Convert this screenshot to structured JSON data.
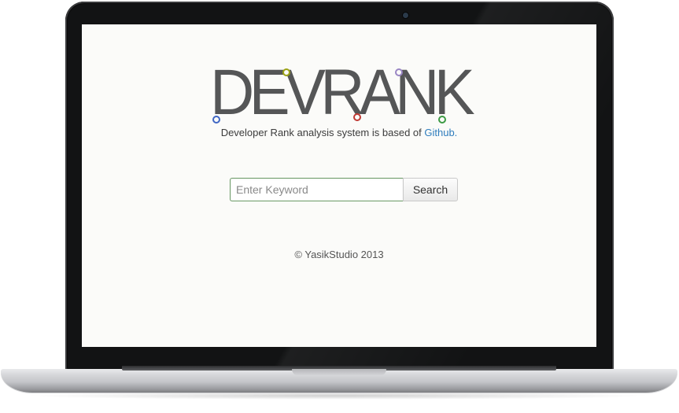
{
  "logo": {
    "text": "DEVRANK",
    "dot_colors": {
      "blue": "#3f66c4",
      "olive": "#9ca314",
      "red": "#c03a34",
      "purple": "#9a86c4",
      "green": "#3c9a43"
    }
  },
  "tagline": {
    "text": "Developer Rank analysis system is based of ",
    "link_label": "Github."
  },
  "search": {
    "placeholder": "Enter Keyword",
    "value": "",
    "button_label": "Search"
  },
  "footer": {
    "copyright": "© YasikStudio 2013"
  },
  "colors": {
    "link": "#2e7cbd",
    "logo_text": "#555657",
    "input_border": "#6a9a65"
  }
}
